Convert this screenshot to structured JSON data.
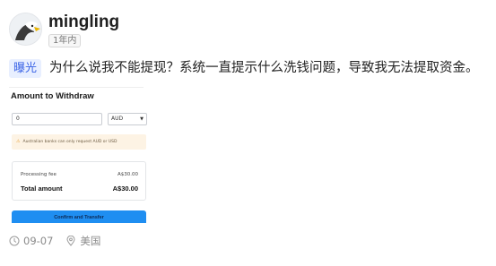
{
  "user": {
    "name": "mingling",
    "time_badge": "1年内",
    "avatar_icon": "eagle-avatar-icon"
  },
  "post": {
    "tag": "曝光",
    "text": "为什么说我不能提现？系统一直提示什么洗钱问题，导致我无法提取资金。"
  },
  "screenshot": {
    "title": "Amount to Withdraw",
    "amount_value": "0",
    "currency_value": "AUD",
    "warning_text": "Australian banks can only request AUD or USD",
    "processing_fee_label": "Processing fee",
    "processing_fee_value": "A$30.00",
    "total_label": "Total amount",
    "total_value": "A$30.00",
    "confirm_label": "Confirm and Transfer"
  },
  "meta": {
    "date": "09-07",
    "location": "美国",
    "clock_icon": "clock-icon",
    "location_icon": "location-pin-icon"
  },
  "colors": {
    "tag_bg": "#e8efff",
    "tag_text": "#3a63e6",
    "button_blue": "#1f8ef1",
    "warning_bg": "#fdf3e4"
  }
}
